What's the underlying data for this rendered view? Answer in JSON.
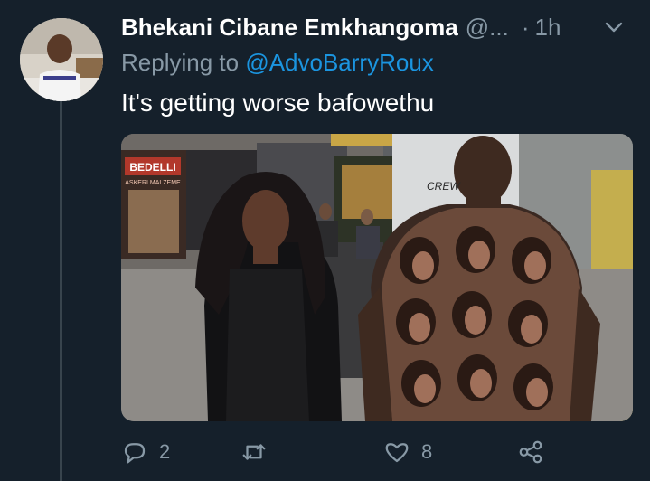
{
  "tweet": {
    "author_name": "Bhekani Cibane Emkhangoma",
    "author_handle": "@...",
    "separator": "·",
    "timestamp": "1h",
    "replying_to_prefix": "Replying to",
    "replying_to_handle": "@AdvoBarryRoux",
    "text": "It's getting worse bafowethu",
    "media": {
      "shop_sign": "BEDELLI",
      "shop_sub": "ASKERI MALZEME",
      "shirt_text": "CREW"
    }
  },
  "actions": {
    "reply_count": "2",
    "retweet_count": "",
    "like_count": "8"
  },
  "icons": {
    "reply": "reply-icon",
    "retweet": "retweet-icon",
    "like": "heart-icon",
    "share": "share-icon",
    "menu": "chevron-down-icon"
  },
  "colors": {
    "background": "#15202b",
    "primary_text": "#ffffff",
    "secondary_text": "#8899a6",
    "link": "#1b95e0",
    "thread_line": "#38444d"
  }
}
